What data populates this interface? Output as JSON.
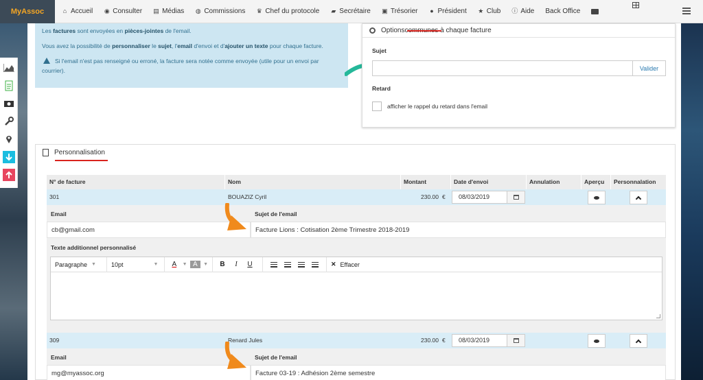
{
  "brand": "MyAssoc",
  "nav": [
    {
      "label": "Accueil",
      "icon": "home-icon"
    },
    {
      "label": "Consulter",
      "icon": "eye-icon"
    },
    {
      "label": "Médias",
      "icon": "file-icon"
    },
    {
      "label": "Commissions",
      "icon": "users-icon"
    },
    {
      "label": "Chef du protocole",
      "icon": "trophy-icon"
    },
    {
      "label": "Secrétaire",
      "icon": "book-icon"
    },
    {
      "label": "Trésorier",
      "icon": "money-icon"
    },
    {
      "label": "Président",
      "icon": "globe-icon"
    },
    {
      "label": "Club",
      "icon": "star-icon"
    },
    {
      "label": "Aide",
      "icon": "info-icon"
    },
    {
      "label": "Back Office",
      "icon": ""
    }
  ],
  "info": {
    "line1_pre": "Les ",
    "line1_b1": "factures",
    "line1_mid": " sont envoyées en ",
    "line1_b2": "pièces-jointes",
    "line1_post": " de l'email.",
    "line2_pre": "Vous avez la possibilité de ",
    "line2_b1": "personnaliser",
    "line2_m1": " le ",
    "line2_b2": "sujet",
    "line2_m2": ", l'",
    "line2_b3": "email",
    "line2_m3": " d'envoi et d'",
    "line2_b4": "ajouter un texte",
    "line2_post": " pour chaque facture.",
    "warning": "Si l'email n'est pas renseigné ou erroné, la facture sera notée comme envoyée (utile pour un envoi par courrier)."
  },
  "options": {
    "title_pre": "Options ",
    "title_u": "communes",
    "title_post": " à chaque facture",
    "subject_label": "Sujet",
    "subject_value": "",
    "validate": "Valider",
    "late_label": "Retard",
    "late_checkbox": "afficher le rappel du retard dans l'email"
  },
  "perso": {
    "title": "Personnalisation",
    "columns": [
      "N° de facture",
      "Nom",
      "Montant",
      "Date d'envoi",
      "Annulation",
      "Aperçu",
      "Personnalation"
    ],
    "rows": [
      {
        "number": "301",
        "name": "BOUAZIZ Cyril",
        "amount": "230.00",
        "currency": "€",
        "date": "08/03/2019",
        "email_label": "Email",
        "email": "cb@gmail.com",
        "subject_label": "Sujet de l'email",
        "subject": "Facture Lions : Cotisation 2ème Trimestre 2018-2019",
        "extra_label": "Texte additionnel personnalisé"
      },
      {
        "number": "309",
        "name": "Renard Jules",
        "amount": "230.00",
        "currency": "€",
        "date": "08/03/2019",
        "email_label": "Email",
        "email": "mg@myassoc.org",
        "subject_label": "Sujet de l'email",
        "subject": "Facture 03-19 : Adhésion 2ème semestre"
      }
    ]
  },
  "editor": {
    "paragraph": "Paragraphe",
    "fontsize": "10pt",
    "clear": "Effacer"
  }
}
